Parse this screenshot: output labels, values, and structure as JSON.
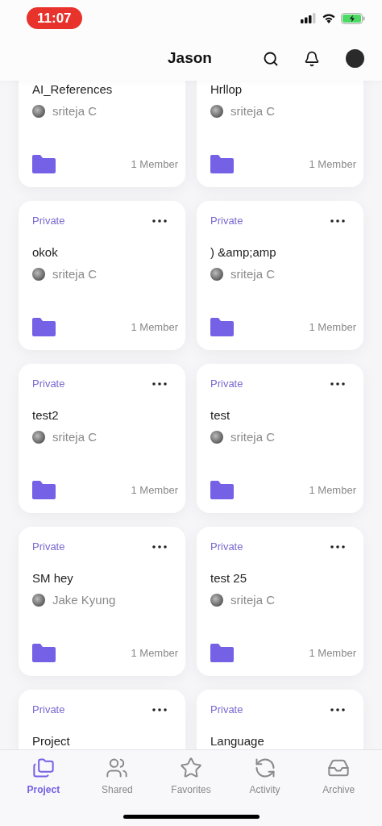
{
  "status_bar": {
    "time": "11:07"
  },
  "header": {
    "title": "Jason"
  },
  "projects": [
    {
      "title": "AI_References",
      "owner": "sriteja C",
      "members": "1 Member"
    },
    {
      "title": "Hrllop",
      "owner": "sriteja C",
      "members": "1 Member"
    },
    {
      "tag": "Private",
      "title": "okok",
      "owner": "sriteja C",
      "members": "1 Member"
    },
    {
      "tag": "Private",
      "title": ") &amp;amp",
      "owner": "sriteja C",
      "members": "1 Member"
    },
    {
      "tag": "Private",
      "title": "test2",
      "owner": "sriteja C",
      "members": "1 Member"
    },
    {
      "tag": "Private",
      "title": "test",
      "owner": "sriteja C",
      "members": "1 Member"
    },
    {
      "tag": "Private",
      "title": "SM hey",
      "owner": "Jake Kyung",
      "members": "1 Member"
    },
    {
      "tag": "Private",
      "title": "test 25",
      "owner": "sriteja C",
      "members": "1 Member"
    },
    {
      "tag": "Private",
      "title": "Project"
    },
    {
      "tag": "Private",
      "title": "Language"
    }
  ],
  "tabs": [
    {
      "label": "Project",
      "kind": "folders",
      "selected": true
    },
    {
      "label": "Shared",
      "kind": "users",
      "selected": false
    },
    {
      "label": "Favorites",
      "kind": "star",
      "selected": false
    },
    {
      "label": "Activity",
      "kind": "refresh",
      "selected": false
    },
    {
      "label": "Archive",
      "kind": "inbox",
      "selected": false
    }
  ]
}
